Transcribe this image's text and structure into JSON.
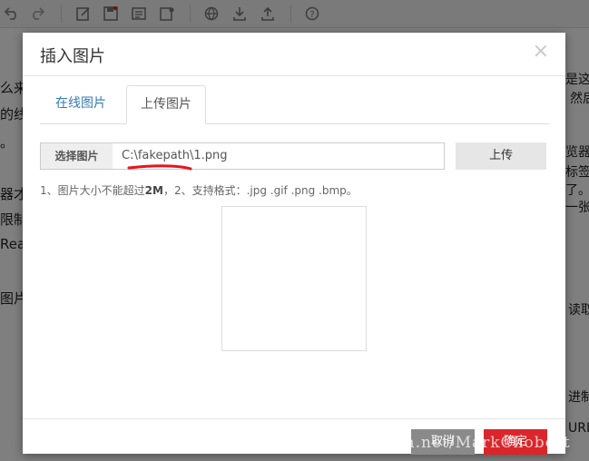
{
  "background": {
    "toolbar_icons": [
      "undo-icon",
      "redo-icon",
      "edit-icon",
      "save-icon",
      "document-icon",
      "settings-document-icon",
      "globe-icon",
      "download-icon",
      "upload-icon",
      "help-icon"
    ],
    "left_text": [
      "么来",
      "的线",
      "。",
      "器才",
      "限制",
      "Rea",
      "图片"
    ],
    "right_text": [
      "是这么",
      "然后",
      "览器",
      "标签",
      "了。",
      "一张图",
      "读取",
      "进制",
      "URL"
    ]
  },
  "modal": {
    "title": "插入图片",
    "close_glyph": "×",
    "tabs": [
      {
        "label": "在线图片",
        "active": false
      },
      {
        "label": "上传图片",
        "active": true
      }
    ],
    "file_label": "选择图片",
    "file_value": "C:\\fakepath\\1.png",
    "upload_button": "上传",
    "hint_prefix": "1、图片大小不能超过",
    "hint_size": "2M",
    "hint_suffix": "，2、支持格式：.jpg .gif .png .bmp。",
    "cancel_button": "取消",
    "confirm_button": "确定"
  },
  "watermark": "http://blog.csdn.net/MarkChobert",
  "colors": {
    "tab_link": "#337ab7",
    "confirm": "#d9262b",
    "cancel": "#8a8a8a",
    "annotation_red": "#e8141c"
  }
}
